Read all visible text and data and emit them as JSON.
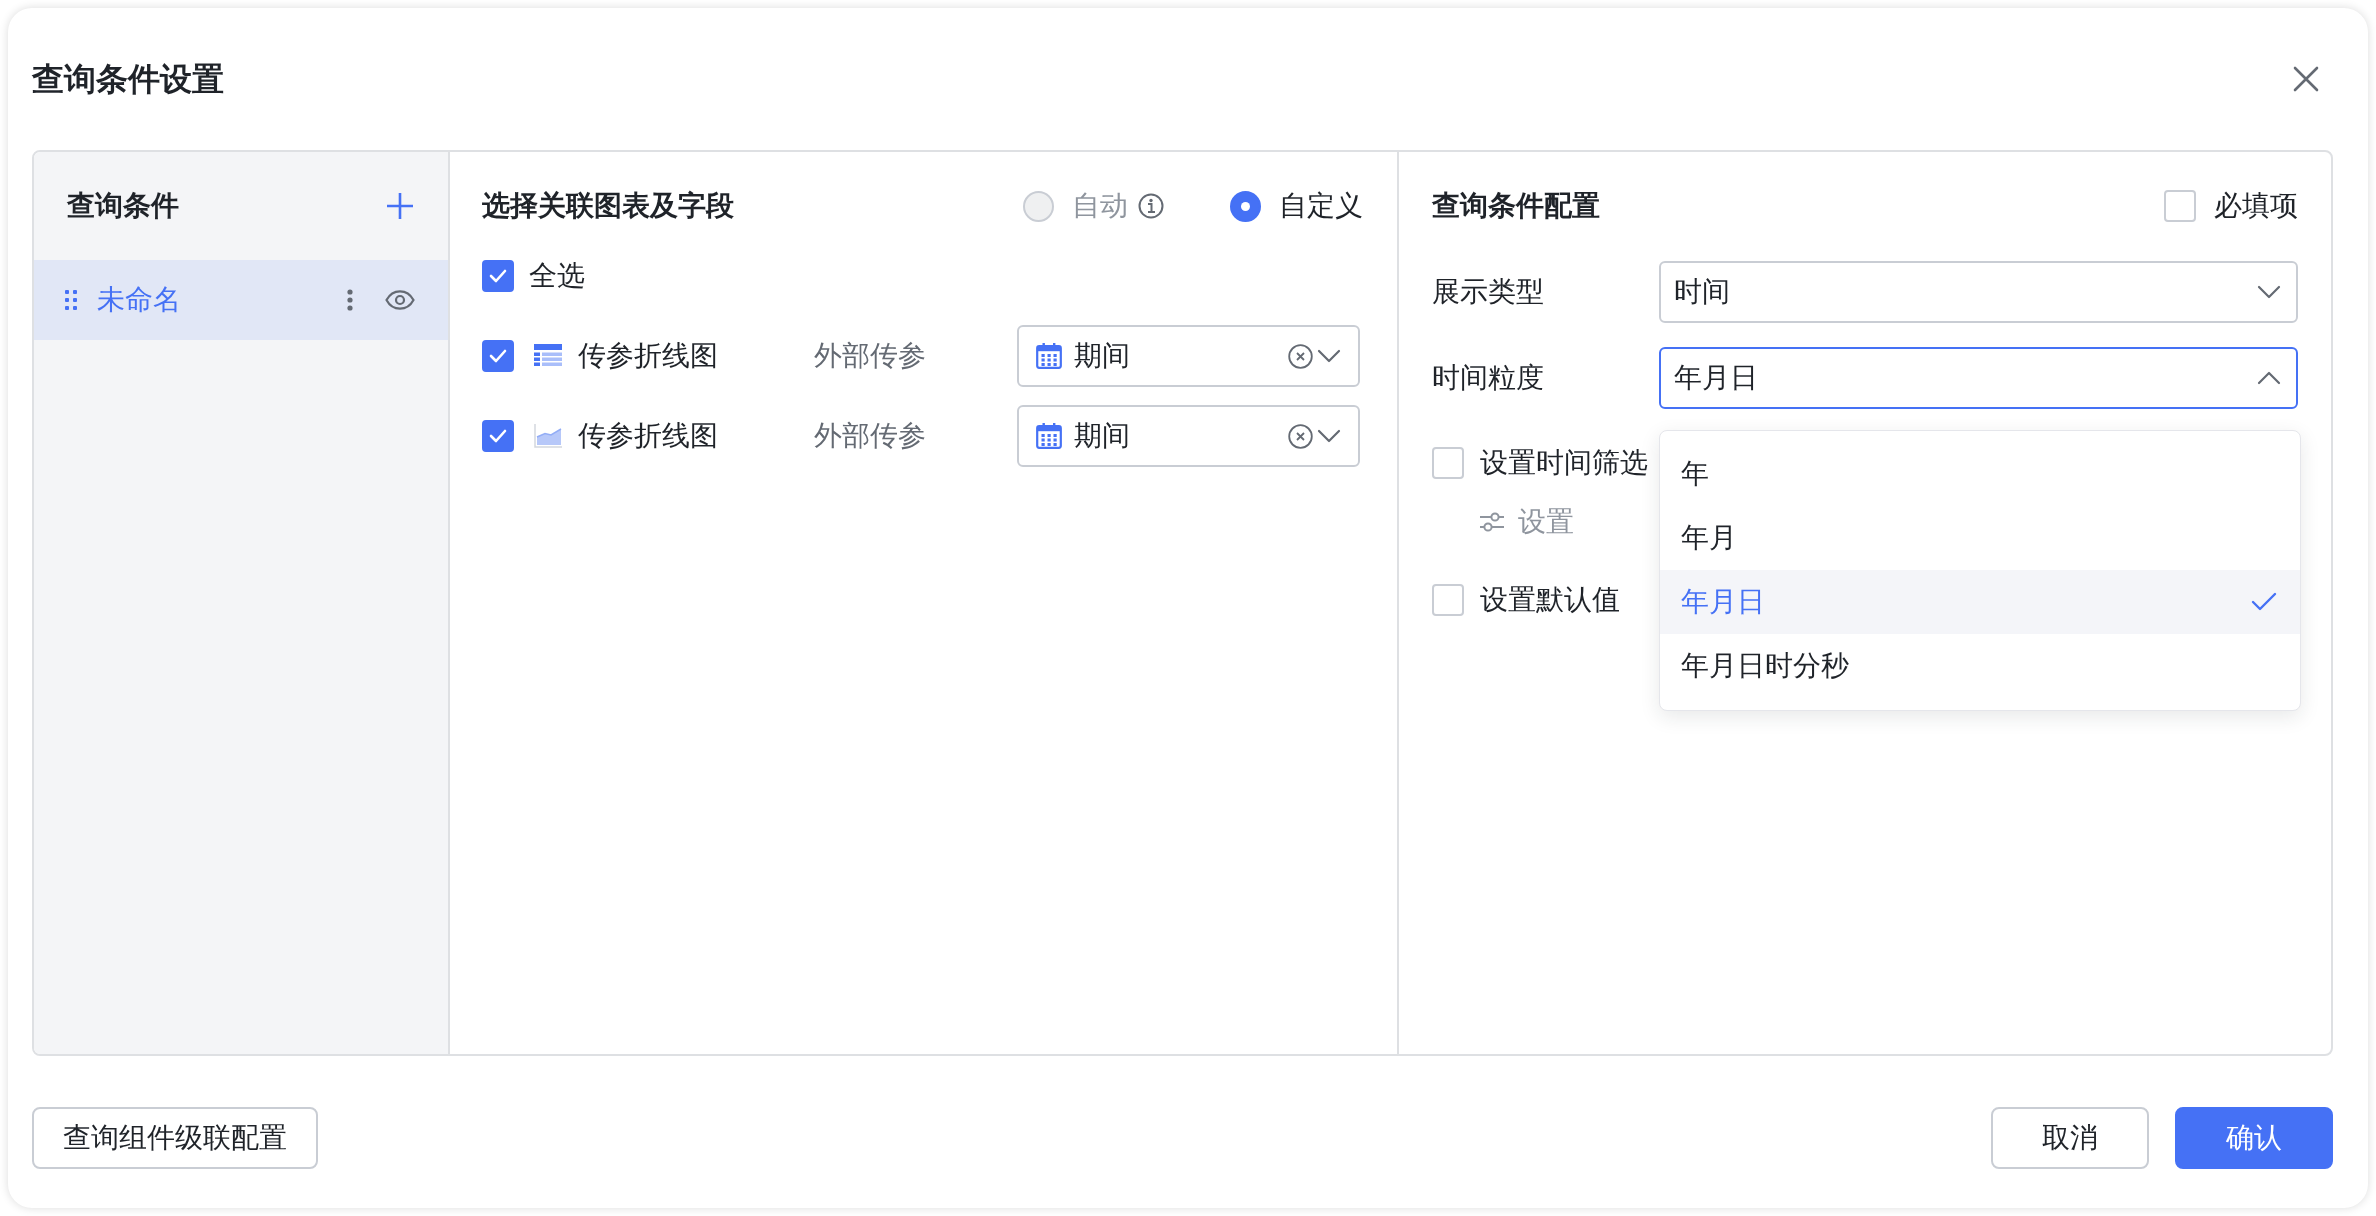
{
  "dialog": {
    "title": "查询条件设置"
  },
  "conditions_panel": {
    "title": "查询条件",
    "items": [
      {
        "label": "未命名",
        "selected": true
      }
    ]
  },
  "link_panel": {
    "title": "选择关联图表及字段",
    "modes": [
      {
        "label": "自动",
        "selected": false,
        "disabled": true,
        "info": true
      },
      {
        "label": "自定义",
        "selected": true,
        "disabled": false,
        "info": false
      }
    ],
    "select_all": {
      "label": "全选",
      "checked": true
    },
    "rows": [
      {
        "kind": "table",
        "checked": true,
        "chart": "传参折线图",
        "param": "外部传参",
        "field": "期间"
      },
      {
        "kind": "area",
        "checked": true,
        "chart": "传参折线图",
        "param": "外部传参",
        "field": "期间"
      }
    ]
  },
  "config_panel": {
    "title": "查询条件配置",
    "required": {
      "label": "必填项",
      "checked": false
    },
    "fields": [
      {
        "label": "展示类型",
        "value": "时间",
        "open": false
      },
      {
        "label": "时间粒度",
        "value": "年月日",
        "open": true,
        "options": [
          {
            "label": "年",
            "selected": false
          },
          {
            "label": "年月",
            "selected": false
          },
          {
            "label": "年月日",
            "selected": true
          },
          {
            "label": "年月日时分秒",
            "selected": false
          }
        ]
      }
    ],
    "checks": [
      {
        "label": "设置时间筛选",
        "checked": false,
        "setting": {
          "label": "设置",
          "disabled": true
        }
      },
      {
        "label": "设置默认值",
        "checked": false
      }
    ]
  },
  "footer": {
    "cascade_button": "查询组件级联配置",
    "cancel_button": "取消",
    "confirm_button": "确认"
  }
}
